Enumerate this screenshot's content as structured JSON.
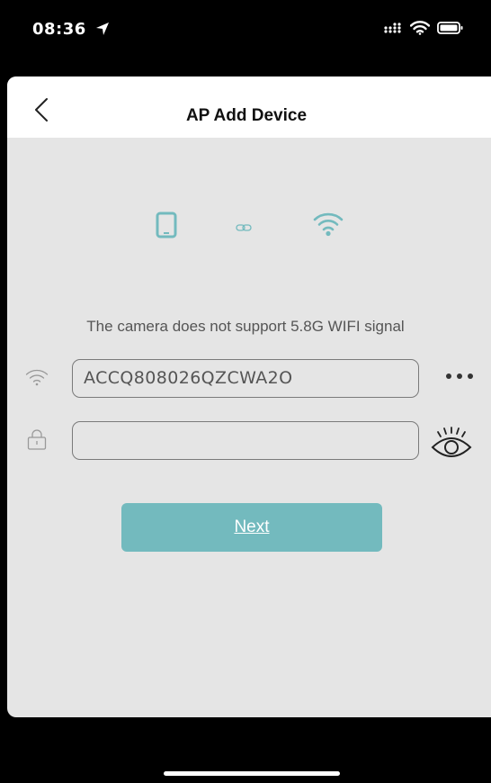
{
  "status_bar": {
    "time": "08:36",
    "icons": [
      "location-arrow-icon",
      "cellular-signal-icon",
      "wifi-icon",
      "battery-icon"
    ]
  },
  "nav": {
    "back_icon": "chevron-left-icon",
    "title": "AP Add Device"
  },
  "illustration": {
    "icons": [
      "phone-icon",
      "link-icon",
      "wifi-icon"
    ],
    "accent_color": "#73babe"
  },
  "notice_text": "The camera does not support 5.8G WIFI signal",
  "wifi_row": {
    "icon": "wifi-icon",
    "ssid_value": "ACCQ808026QZCWA2O",
    "more_icon": "more-dots-icon"
  },
  "password_row": {
    "icon": "lock-icon",
    "value": "",
    "placeholder": "",
    "toggle_icon": "eye-icon"
  },
  "next_button": {
    "label": "Next",
    "color": "#73babe"
  },
  "colors": {
    "sheet_background": "#e5e5e5",
    "nav_background": "#ffffff",
    "screen_background": "#000000"
  }
}
